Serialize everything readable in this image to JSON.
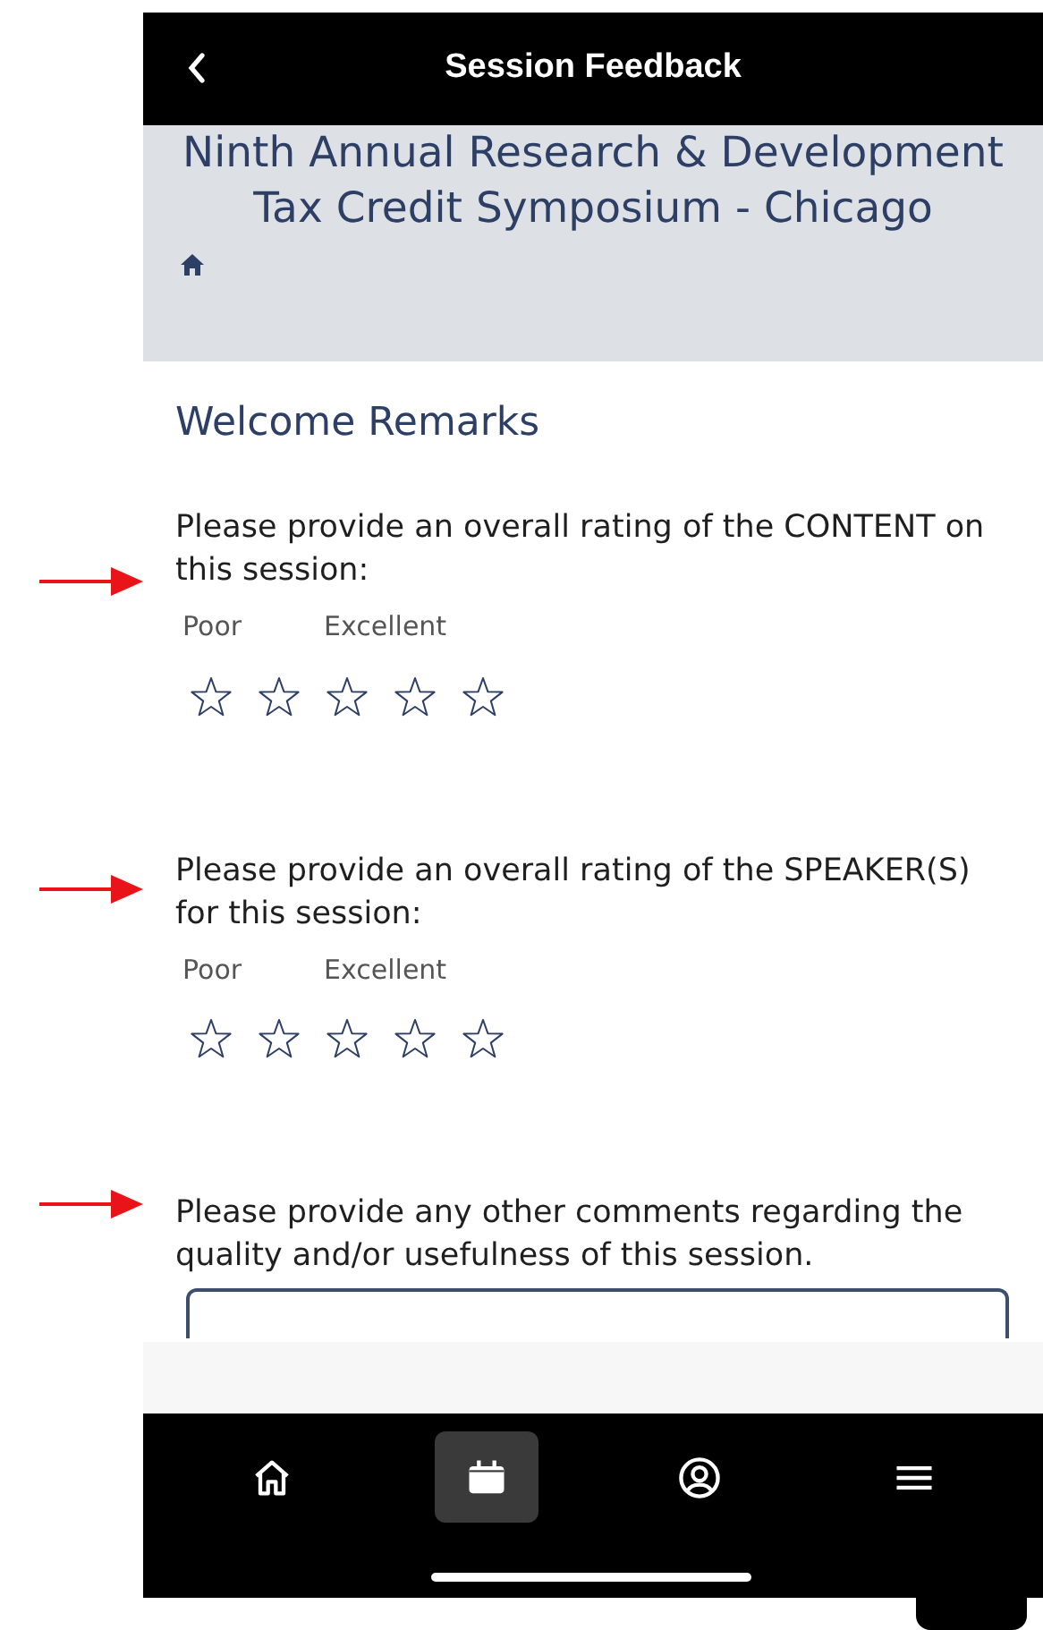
{
  "header": {
    "title": "Session Feedback"
  },
  "event": {
    "title": "Ninth Annual Research & Development Tax Credit Symposium - Chicago"
  },
  "session": {
    "title": "Welcome Remarks"
  },
  "questions": [
    {
      "kind": "rating",
      "prompt": "Please provide an overall rating of the CONTENT on this session:",
      "low_label": "Poor",
      "high_label": "Excellent",
      "stars": 0
    },
    {
      "kind": "rating",
      "prompt": "Please provide an overall rating of the SPEAKER(S) for this session:",
      "low_label": "Poor",
      "high_label": "Excellent",
      "stars": 0
    },
    {
      "kind": "comment",
      "prompt": "Please provide any other comments regarding the quality and/or usefulness of this session."
    }
  ],
  "nav": [
    {
      "selected": false
    },
    {
      "selected": true
    },
    {
      "selected": false
    },
    {
      "selected": false
    }
  ]
}
